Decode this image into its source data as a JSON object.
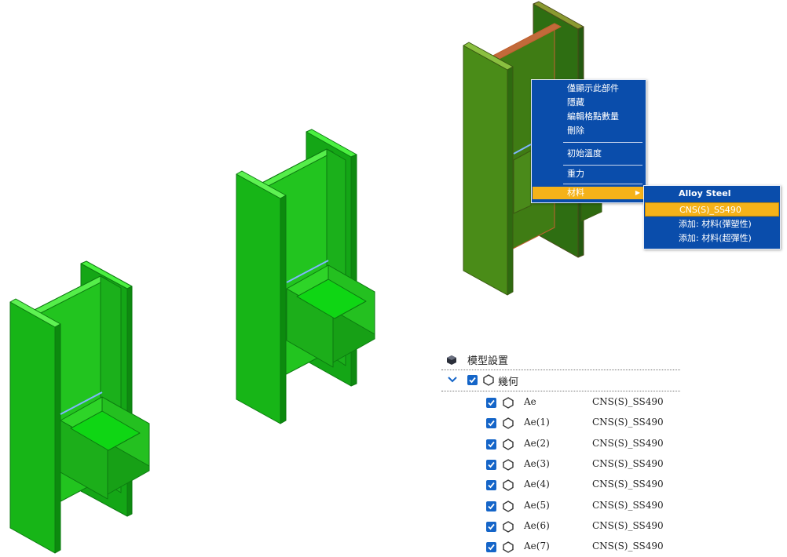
{
  "context_menu": {
    "items": [
      "僅顯示此部件",
      "隱藏",
      "編輯格點數量",
      "刪除",
      "初始溫度",
      "重力",
      "材料"
    ],
    "submenu": {
      "items": [
        "Alloy Steel",
        "CNS(S)_SS490",
        "添加: 材料(彈塑性)",
        "添加: 材料(超彈性)"
      ],
      "highlighted": "CNS(S)_SS490"
    },
    "highlighted": "材料"
  },
  "tree": {
    "header": "模型設置",
    "group": {
      "label": "幾何",
      "checked": true,
      "expanded": true
    },
    "rows": [
      {
        "name": "Ae",
        "material": "CNS(S)_SS490",
        "checked": true
      },
      {
        "name": "Ae(1)",
        "material": "CNS(S)_SS490",
        "checked": true
      },
      {
        "name": "Ae(2)",
        "material": "CNS(S)_SS490",
        "checked": true
      },
      {
        "name": "Ae(3)",
        "material": "CNS(S)_SS490",
        "checked": true
      },
      {
        "name": "Ae(4)",
        "material": "CNS(S)_SS490",
        "checked": true
      },
      {
        "name": "Ae(5)",
        "material": "CNS(S)_SS490",
        "checked": true
      },
      {
        "name": "Ae(6)",
        "material": "CNS(S)_SS490",
        "checked": true
      },
      {
        "name": "Ae(7)",
        "material": "CNS(S)_SS490",
        "checked": true
      }
    ]
  },
  "colors": {
    "part_green": "#19c21a",
    "part_green_light": "#3fe23a",
    "menu_blue": "#0a4dab",
    "menu_highlight": "#f5b219",
    "selected_part": "#7a3a12",
    "checkbox_blue": "#1565c8"
  },
  "icons": [
    "model-settings-icon",
    "chevron-down-icon",
    "hexagon-icon",
    "checkbox-icon",
    "submenu-arrow-icon"
  ]
}
